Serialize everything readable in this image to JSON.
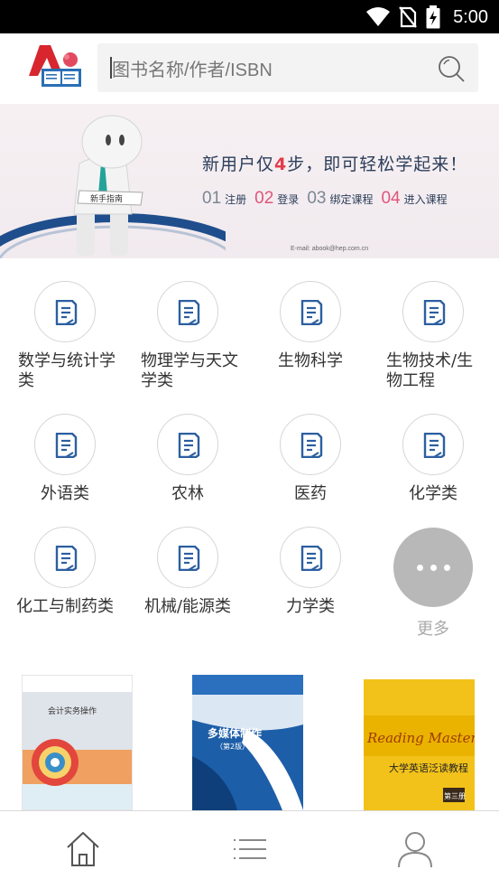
{
  "status_bar": {
    "time": "5:00",
    "icons": [
      "wifi-icon",
      "no-sim-icon",
      "battery-charging-icon"
    ]
  },
  "header": {
    "logo": "publisher-logo",
    "search": {
      "placeholder": "图书名称/作者/ISBN",
      "icon": "search-icon"
    }
  },
  "banner": {
    "figure_label": "新手指南",
    "headline_pre": "新用户仅",
    "headline_num": "4",
    "headline_post": "步，即可轻松学起来！",
    "steps": [
      {
        "num": "01",
        "label": "注册"
      },
      {
        "num": "02",
        "label": "登录"
      },
      {
        "num": "03",
        "label": "绑定课程"
      },
      {
        "num": "04",
        "label": "进入课程"
      }
    ],
    "email": "E-mail:  abook@hep.com.cn",
    "colors": {
      "accent": "#e23b4b",
      "step_highlight": "#e0557a",
      "text": "#2c3e5a"
    }
  },
  "categories": [
    {
      "label": "数学与统计学类",
      "icon": "book-document-icon"
    },
    {
      "label": "物理学与天文学类",
      "icon": "book-document-icon"
    },
    {
      "label": "生物科学",
      "icon": "book-document-icon"
    },
    {
      "label": "生物技术/生物工程",
      "icon": "book-document-icon"
    },
    {
      "label": "外语类",
      "icon": "book-document-icon"
    },
    {
      "label": "农林",
      "icon": "book-document-icon"
    },
    {
      "label": "医药",
      "icon": "book-document-icon"
    },
    {
      "label": "化学类",
      "icon": "book-document-icon"
    },
    {
      "label": "化工与制药类",
      "icon": "book-document-icon"
    },
    {
      "label": "机械/能源类",
      "icon": "book-document-icon"
    },
    {
      "label": "力学类",
      "icon": "book-document-icon"
    }
  ],
  "more": {
    "label": "更多",
    "icon": "more-dots-icon"
  },
  "books": [
    {
      "title": "会计实务操作"
    },
    {
      "title": "多媒体制作",
      "edition": "（第2版）"
    },
    {
      "title_en": "Reading Master",
      "title_cn": "大学英语泛读教程",
      "volume": "第三册"
    }
  ],
  "bottom_nav": [
    {
      "name": "home",
      "icon": "home-icon"
    },
    {
      "name": "list",
      "icon": "list-icon"
    },
    {
      "name": "profile",
      "icon": "user-icon"
    }
  ]
}
